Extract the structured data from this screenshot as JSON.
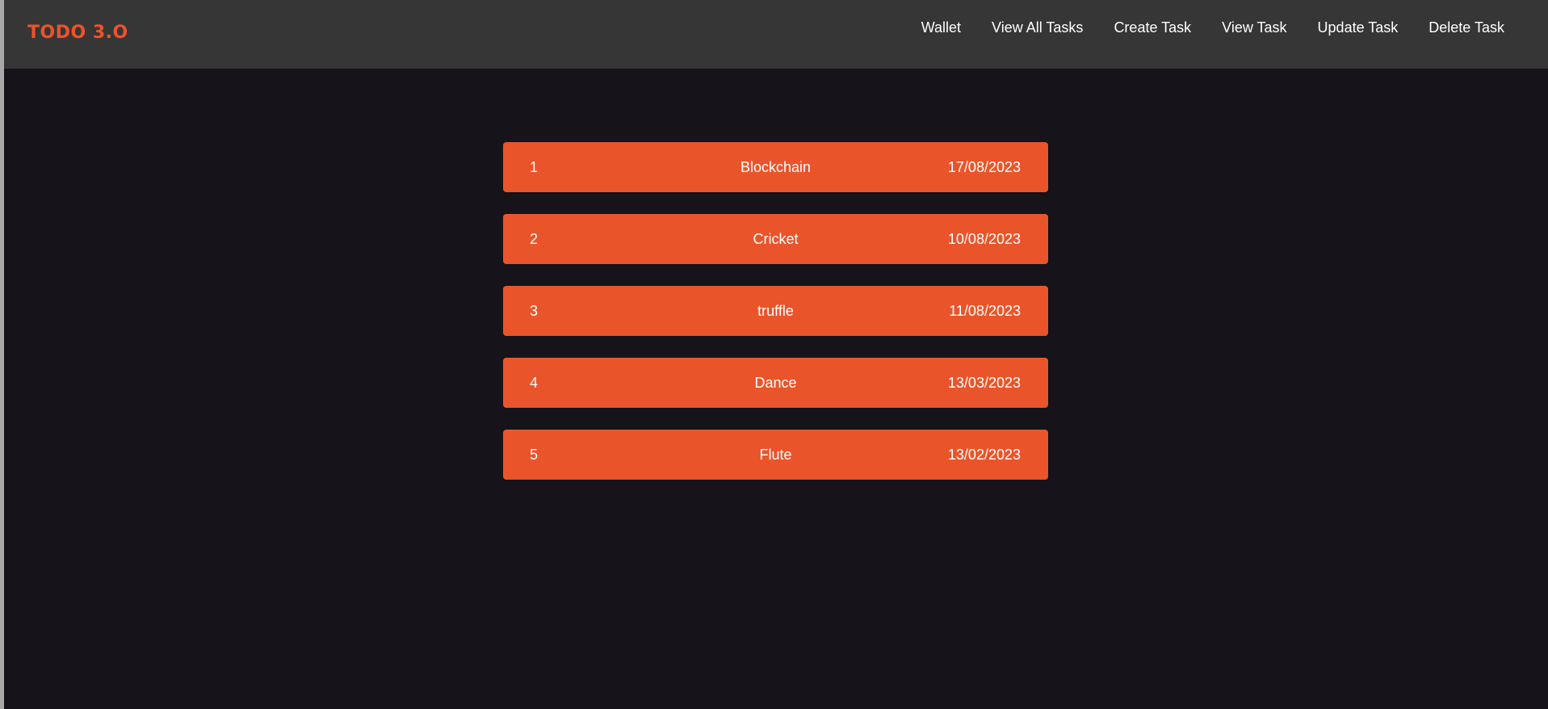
{
  "brand": {
    "title": "TODO 3.O"
  },
  "nav": {
    "items": [
      {
        "label": "Wallet"
      },
      {
        "label": "View All Tasks"
      },
      {
        "label": "Create Task"
      },
      {
        "label": "View Task"
      },
      {
        "label": "Update Task"
      },
      {
        "label": "Delete Task"
      }
    ]
  },
  "tasks": [
    {
      "id": "1",
      "name": "Blockchain",
      "date": "17/08/2023"
    },
    {
      "id": "2",
      "name": "Cricket",
      "date": "10/08/2023"
    },
    {
      "id": "3",
      "name": "truffle",
      "date": "11/08/2023"
    },
    {
      "id": "4",
      "name": "Dance",
      "date": "13/03/2023"
    },
    {
      "id": "5",
      "name": "Flute",
      "date": "13/02/2023"
    }
  ],
  "colors": {
    "brand": "#ec532a",
    "navbar": "#363636",
    "background": "#16131a",
    "task_row": "#ea542b",
    "text": "#ffffff"
  }
}
